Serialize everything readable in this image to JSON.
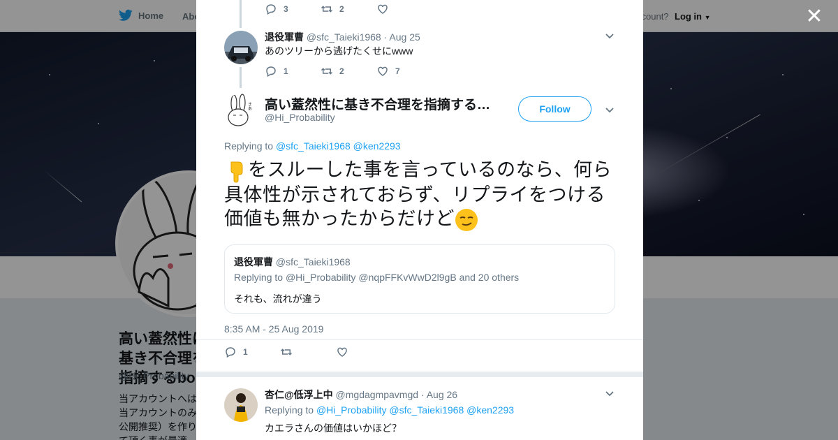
{
  "background": {
    "nav_home": "Home",
    "nav_about": "Abo",
    "nav_account": "ccount?",
    "nav_login": "Log in",
    "profile_name": "高い蓋然性に基き不合理を指摘するbo",
    "profile_handle": "@Hi_Probability",
    "profile_bio": "当アカウントへは 当アカウントのみ 公開推奨）を作り て頂く事が最適"
  },
  "thread": {
    "prev_tweet_stats": {
      "replies": "3",
      "retweets": "2",
      "likes": ""
    },
    "reply_tweet": {
      "name": "退役軍曹",
      "handle": "@sfc_Taieki1968",
      "date": "· Aug 25",
      "text": "あのツリーから逃げたくせにwww",
      "replies": "1",
      "retweets": "2",
      "likes": "7"
    }
  },
  "main_tweet": {
    "name": "高い蓋然性に基き不合理を指摘する…",
    "handle": "@Hi_Probability",
    "follow_label": "Follow",
    "replying_prefix": "Replying to",
    "replying_to": [
      "@sfc_Taieki1968",
      "@ken2293"
    ],
    "text": "をスルーした事を言っているのなら、何ら具体性が示されておらず、リプライをつける価値も無かったからだけど",
    "timestamp": "8:35 AM - 25 Aug 2019",
    "replies": "1",
    "retweets": "",
    "likes": ""
  },
  "quoted_tweet": {
    "name": "退役軍曹",
    "handle": "@sfc_Taieki1968",
    "replying_prefix": "Replying to",
    "replying_to": "@Hi_Probability @nqpFFKvWwD2l9gB",
    "replying_suffix": "and 20 others",
    "text": "それも、流れが違う"
  },
  "next_reply": {
    "name": "杏仁@低浮上中",
    "handle": "@mgdagmpavmgd",
    "date": "· Aug 26",
    "replying_prefix": "Replying to",
    "replying_to": "@Hi_Probability @sfc_Taieki1968 @ken2293",
    "text": "カエラさんの価値はいかほど？"
  },
  "colors": {
    "accent": "#1da1f2",
    "muted": "#657786",
    "text": "#14171a"
  },
  "icons": [
    "twitter-bird-icon",
    "reply-icon",
    "retweet-icon",
    "like-icon",
    "chevron-down-icon",
    "close-icon",
    "pointing-down-emoji",
    "smirk-emoji"
  ]
}
